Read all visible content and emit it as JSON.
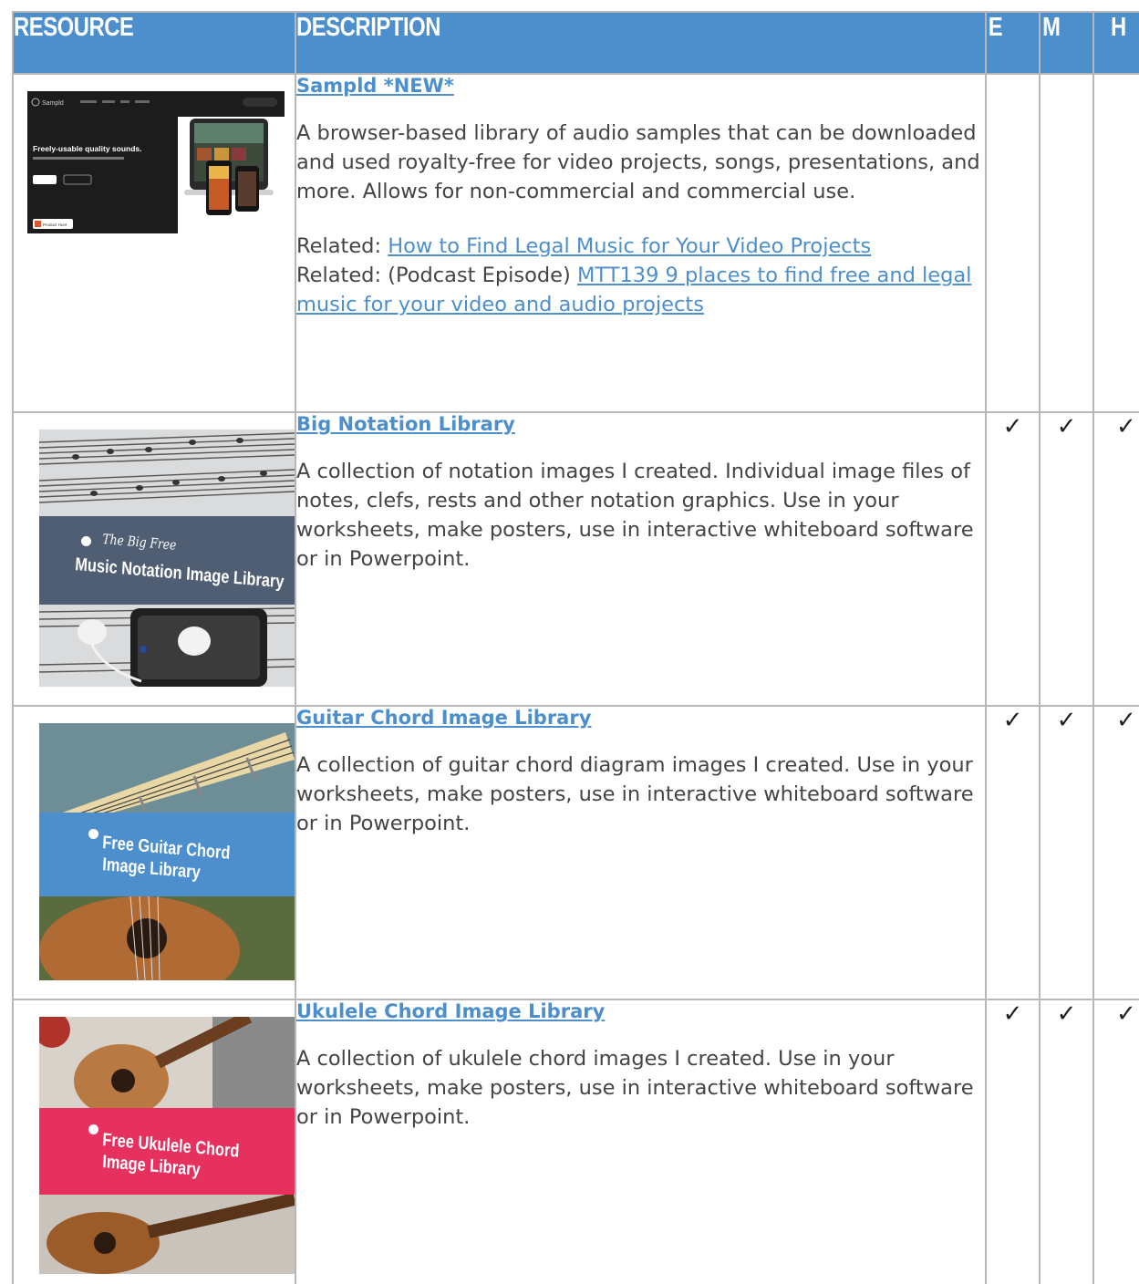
{
  "header": {
    "resource": "RESOURCE",
    "description": "DESCRIPTION",
    "e": "E",
    "m": "M",
    "h": "H"
  },
  "rows": [
    {
      "title": "Sampld *NEW*",
      "description": "A browser-based library of audio samples that can be downloaded and used royalty-free for video projects, songs, presentations, and more. Allows for non-commercial and commercial use.",
      "related_prefix_1": "Related: ",
      "related_link_1": "How to Find Legal Music for Your Video Projects",
      "related_prefix_2": "Related: (Podcast Episode) ",
      "related_link_2": "MTT139 9 places to find free and legal music for your video and audio projects",
      "thumb": {
        "headline": "Freely-usable quality sounds.",
        "brand": "Sampld",
        "badge": "Product Hunt"
      },
      "checks": {
        "e": "",
        "m": "",
        "h": ""
      }
    },
    {
      "title": "Big Notation Library",
      "description": "A collection of notation images I created. Individual image files of notes, clefs, rests and other notation graphics. Use in your worksheets, make posters, use in interactive whiteboard software or in Powerpoint.",
      "thumb": {
        "line1": "The Big Free",
        "line2": "Music Notation Image Library"
      },
      "checks": {
        "e": "✓",
        "m": "✓",
        "h": "✓"
      }
    },
    {
      "title": "Guitar Chord Image Library",
      "description": "A collection of guitar chord diagram images I created. Use in your worksheets, make posters, use in interactive whiteboard software or in Powerpoint.",
      "thumb": {
        "line1": "Free Guitar Chord",
        "line2": "Image Library"
      },
      "checks": {
        "e": "✓",
        "m": "✓",
        "h": "✓"
      }
    },
    {
      "title": "Ukulele Chord Image Library",
      "description": "A collection of ukulele chord images I created. Use in your worksheets, make posters, use in interactive whiteboard software or in Powerpoint.",
      "thumb": {
        "line1": "Free Ukulele Chord",
        "line2": "Image Library"
      },
      "checks": {
        "e": "✓",
        "m": "✓",
        "h": "✓"
      }
    }
  ]
}
